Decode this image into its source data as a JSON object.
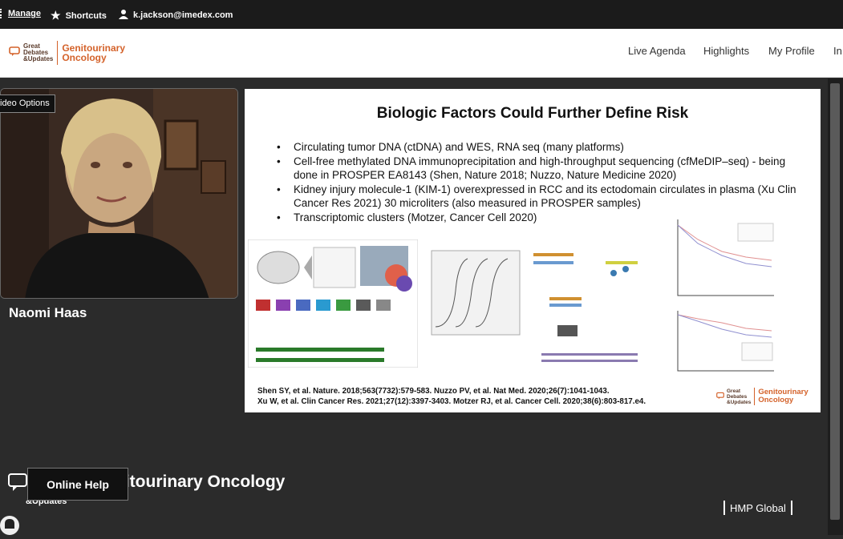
{
  "topbar": {
    "manage_label": "Manage",
    "shortcuts_label": "Shortcuts",
    "user_email": "k.jackson@imedex.com"
  },
  "header": {
    "logo_small_lines": [
      "Great",
      "Debates",
      "&Updates"
    ],
    "logo_brand_lines": [
      "Genitourinary",
      "Oncology"
    ],
    "nav": [
      "Live Agenda",
      "Highlights",
      "My Profile",
      "In"
    ]
  },
  "video": {
    "options_label": "ideo Options",
    "speaker_name": "Naomi Haas"
  },
  "slide": {
    "title": "Biologic Factors Could Further Define Risk",
    "bullets": [
      "Circulating tumor DNA (ctDNA) and WES, RNA seq (many platforms)",
      "Cell-free methylated DNA immunoprecipitation and high-throughput sequencing (cfMeDIP–seq) - being done in PROSPER EA8143 (Shen, Nature 2018; Nuzzo, Nature Medicine 2020)",
      "Kidney injury molecule-1 (KIM-1) overexpressed in RCC and its ectodomain circulates in plasma (Xu Clin Cancer Res 2021) 30 microliters (also measured in PROSPER samples)",
      "Transcriptomic clusters (Motzer, Cancer Cell 2020)"
    ],
    "ref_line1": "Shen SY, et al. Nature. 2018;563(7732):579-583. Nuzzo PV, et al. Nat Med. 2020;26(7):1041-1043.",
    "ref_line2": "Xu W, et al. Clin Cancer Res. 2021;27(12):3397-3403. Motzer RJ, et al. Cancer Cell. 2020;38(6):803-817.e4."
  },
  "footer": {
    "brand": "Genitourinary Oncology",
    "small": "&Updates",
    "help_label": "Online Help",
    "hmp_label": "HMP Global"
  },
  "colors": {
    "brand_orange": "#d4622a",
    "topbar_bg": "#1b1b1b",
    "page_bg": "#2b2b2b"
  },
  "icons": [
    "manage-icon",
    "star-icon",
    "user-icon",
    "chat-icon",
    "bell-icon"
  ]
}
